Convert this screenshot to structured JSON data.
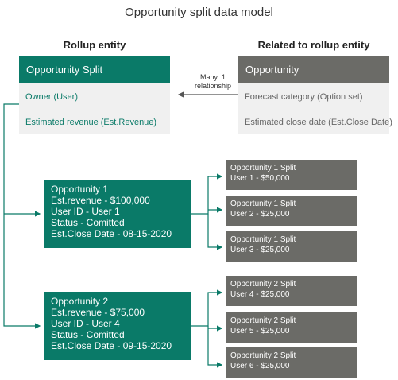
{
  "title": "Opportunity split data model",
  "rollup_heading": "Rollup entity",
  "related_heading": "Related to rollup entity",
  "rollup_entity": {
    "name": "Opportunity Split",
    "fields": [
      "Owner (User)",
      "Estimated revenue (Est.Revenue)"
    ]
  },
  "related_entity": {
    "name": "Opportunity",
    "fields": [
      "Forecast category (Option set)",
      "Estimated close date (Est.Close Date)"
    ]
  },
  "relationship": {
    "line1": "Many :1",
    "line2": "relationship"
  },
  "opportunities": [
    {
      "lines": [
        "Opportunity 1",
        "Est.revenue - $100,000",
        "User ID - User 1",
        "Status - Comitted",
        "Est.Close Date - 08-15-2020"
      ],
      "splits": [
        {
          "title": "Opportunity 1 Split",
          "detail": "User 1 - $50,000"
        },
        {
          "title": "Opportunity 1 Split",
          "detail": "User 2 - $25,000"
        },
        {
          "title": "Opportunity 1 Split",
          "detail": "User 3 - $25,000"
        }
      ]
    },
    {
      "lines": [
        "Opportunity 2",
        "Est.revenue - $75,000",
        "User ID - User 4",
        "Status - Comitted",
        "Est.Close Date - 09-15-2020"
      ],
      "splits": [
        {
          "title": "Opportunity 2 Split",
          "detail": "User 4 - $25,000"
        },
        {
          "title": "Opportunity 2 Split",
          "detail": "User 5 - $25,000"
        },
        {
          "title": "Opportunity 2 Split",
          "detail": "User 6 - $25,000"
        }
      ]
    }
  ],
  "colors": {
    "teal": "#0a7a68",
    "gray": "#6b6b67",
    "panel": "#f0f0f0",
    "arrow_gray": "#555555"
  }
}
